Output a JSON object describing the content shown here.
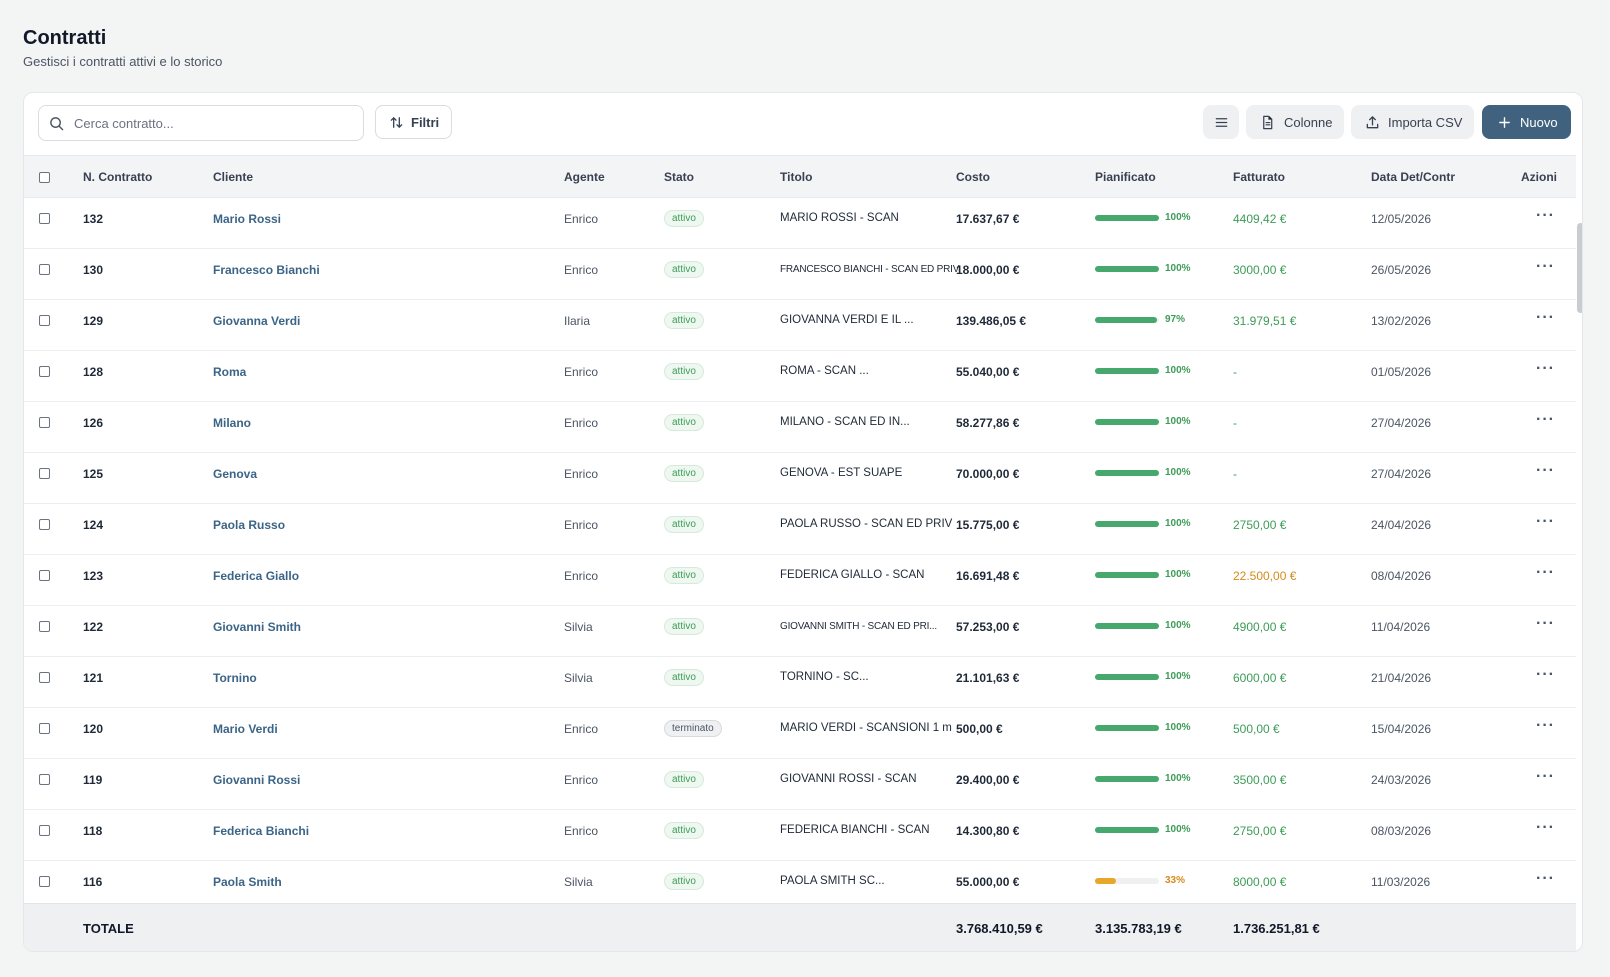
{
  "page": {
    "title": "Contratti",
    "subtitle": "Gestisci i contratti attivi e lo storico"
  },
  "toolbar": {
    "search_placeholder": "Cerca contratto...",
    "filters_label": "Filtri",
    "columns_label": "Colonne",
    "import_label": "Importa CSV",
    "new_label": "Nuovo"
  },
  "table": {
    "headers": {
      "number": "N. Contratto",
      "client": "Cliente",
      "agent": "Agente",
      "status": "Stato",
      "title": "Titolo",
      "cost": "Costo",
      "planned": "Pianificato",
      "invoiced": "Fatturato",
      "date": "Data Det/Contr",
      "actions": "Azioni"
    },
    "rows": [
      {
        "number": "132",
        "client": "Mario Rossi",
        "agent": "Enrico",
        "status": "attivo",
        "title": "MARIO ROSSI - SCAN",
        "cost": "17.637,67 €",
        "planned_pct": 100,
        "planned_label": "100%",
        "invoiced": "4409,42 €",
        "invoiced_tone": "ok",
        "date": "12/05/2026"
      },
      {
        "number": "130",
        "client": "Francesco Bianchi",
        "agent": "Enrico",
        "status": "attivo",
        "title": "FRANCESCO BIANCHI - SCAN ED PRIV",
        "cost": "18.000,00 €",
        "planned_pct": 100,
        "planned_label": "100%",
        "invoiced": "3000,00 €",
        "invoiced_tone": "ok",
        "date": "26/05/2026"
      },
      {
        "number": "129",
        "client": "Giovanna Verdi",
        "agent": "Ilaria",
        "status": "attivo",
        "title": "GIOVANNA VERDI E IL ...",
        "cost": "139.486,05 €",
        "planned_pct": 97,
        "planned_label": "97%",
        "invoiced": "31.979,51 €",
        "invoiced_tone": "ok",
        "date": "13/02/2026"
      },
      {
        "number": "128",
        "client": "Roma",
        "agent": "Enrico",
        "status": "attivo",
        "title": "ROMA - SCAN ...",
        "cost": "55.040,00 €",
        "planned_pct": 100,
        "planned_label": "100%",
        "invoiced": "-",
        "invoiced_tone": "ok",
        "date": "01/05/2026"
      },
      {
        "number": "126",
        "client": "Milano",
        "agent": "Enrico",
        "status": "attivo",
        "title": "MILANO - SCAN ED IN...",
        "cost": "58.277,86 €",
        "planned_pct": 100,
        "planned_label": "100%",
        "invoiced": "-",
        "invoiced_tone": "ok",
        "date": "27/04/2026"
      },
      {
        "number": "125",
        "client": "Genova",
        "agent": "Enrico",
        "status": "attivo",
        "title": "GENOVA - EST SUAPE",
        "cost": "70.000,00 €",
        "planned_pct": 100,
        "planned_label": "100%",
        "invoiced": "-",
        "invoiced_tone": "ok",
        "date": "27/04/2026"
      },
      {
        "number": "124",
        "client": "Paola Russo",
        "agent": "Enrico",
        "status": "attivo",
        "title": "PAOLA RUSSO - SCAN ED PRIV",
        "cost": "15.775,00 €",
        "planned_pct": 100,
        "planned_label": "100%",
        "invoiced": "2750,00 €",
        "invoiced_tone": "ok",
        "date": "24/04/2026"
      },
      {
        "number": "123",
        "client": "Federica Giallo",
        "agent": "Enrico",
        "status": "attivo",
        "title": "FEDERICA GIALLO - SCAN",
        "cost": "16.691,48 €",
        "planned_pct": 100,
        "planned_label": "100%",
        "invoiced": "22.500,00 €",
        "invoiced_tone": "warn",
        "date": "08/04/2026"
      },
      {
        "number": "122",
        "client": "Giovanni Smith",
        "agent": "Silvia",
        "status": "attivo",
        "title": "GIOVANNI SMITH - SCAN ED PRI...",
        "cost": "57.253,00 €",
        "planned_pct": 100,
        "planned_label": "100%",
        "invoiced": "4900,00 €",
        "invoiced_tone": "ok",
        "date": "11/04/2026"
      },
      {
        "number": "121",
        "client": "Tornino",
        "agent": "Silvia",
        "status": "attivo",
        "title": "TORNINO - SC...",
        "cost": "21.101,63 €",
        "planned_pct": 100,
        "planned_label": "100%",
        "invoiced": "6000,00 €",
        "invoiced_tone": "ok",
        "date": "21/04/2026"
      },
      {
        "number": "120",
        "client": "Mario Verdi",
        "agent": "Enrico",
        "status": "terminato",
        "title": "MARIO VERDI - SCANSIONI 1 m",
        "cost": "500,00 €",
        "planned_pct": 100,
        "planned_label": "100%",
        "invoiced": "500,00 €",
        "invoiced_tone": "ok",
        "date": "15/04/2026"
      },
      {
        "number": "119",
        "client": "Giovanni Rossi",
        "agent": "Enrico",
        "status": "attivo",
        "title": "GIOVANNI ROSSI - SCAN",
        "cost": "29.400,00 €",
        "planned_pct": 100,
        "planned_label": "100%",
        "invoiced": "3500,00 €",
        "invoiced_tone": "ok",
        "date": "24/03/2026"
      },
      {
        "number": "118",
        "client": "Federica Bianchi",
        "agent": "Enrico",
        "status": "attivo",
        "title": "FEDERICA BIANCHI - SCAN",
        "cost": "14.300,80 €",
        "planned_pct": 100,
        "planned_label": "100%",
        "invoiced": "2750,00 €",
        "invoiced_tone": "ok",
        "date": "08/03/2026"
      },
      {
        "number": "116",
        "client": "Paola Smith",
        "agent": "Silvia",
        "status": "attivo",
        "title": "PAOLA SMITH SC...",
        "cost": "55.000,00 €",
        "planned_pct": 33,
        "planned_label": "33%",
        "invoiced": "8000,00 €",
        "invoiced_tone": "ok",
        "date": "11/03/2026"
      }
    ],
    "totals": {
      "label": "TOTALE",
      "cost": "3.768.410,59 €",
      "planned": "3.135.783,19 €",
      "invoiced": "1.736.251,81 €"
    }
  },
  "colors": {
    "primary": "#41627f",
    "success": "#3d9c58",
    "warning": "#d68a1b",
    "link": "#3b6486"
  },
  "icons": {
    "search": "search-icon",
    "filters": "sort-arrows-icon",
    "menu": "list-icon",
    "columns": "document-icon",
    "import": "upload-icon",
    "new": "plus-icon",
    "actions": "more-horizontal-icon"
  }
}
